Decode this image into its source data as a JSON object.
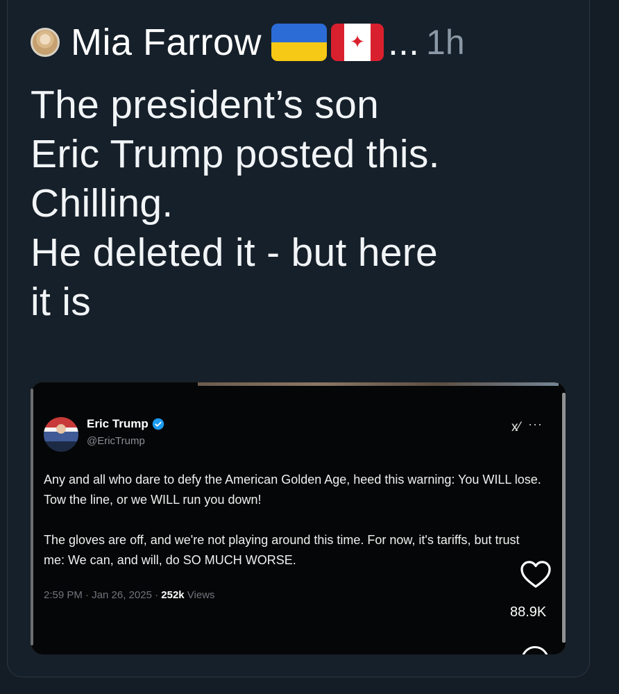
{
  "tweet": {
    "author_name": "Mia Farrow",
    "flags": [
      "ukraine-flag",
      "canada-flag"
    ],
    "truncation": "...",
    "time": "1h",
    "text_lines": [
      "The president’s son",
      "Eric Trump posted this.",
      "Chilling.",
      "He deleted it - but here",
      "it is"
    ]
  },
  "embedded": {
    "name": "Eric Trump",
    "handle": "@EricTrump",
    "grok_label": "x⁄",
    "more": "···",
    "paragraph_1": "Any and all who dare to defy the American Golden Age, heed this warning: You WILL lose. Tow the line, or we WILL run you down!",
    "paragraph_2": "The gloves are off, and we're not playing around this time. For now, it's tariffs, but trust me: We can, and will, do SO MUCH WORSE.",
    "meta_time": "2:59 PM · Jan 26, 2025 · ",
    "meta_views_count": "252k",
    "meta_views_label": " Views",
    "likes": "88.9K",
    "colors": {
      "verified": "#1d9bf0"
    }
  }
}
